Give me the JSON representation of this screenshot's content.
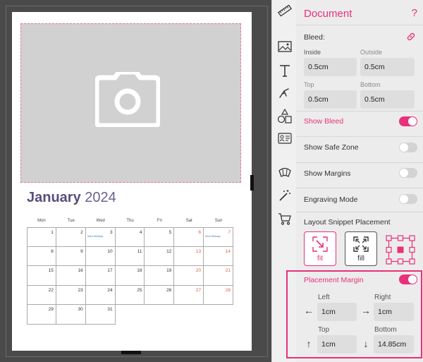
{
  "calendar": {
    "month": "January",
    "year": "2024",
    "weekdays": [
      "Mon",
      "Tue",
      "Wed",
      "Thu",
      "Fri",
      "Sat",
      "Sun"
    ],
    "leading_blanks": 0,
    "days": [
      {
        "d": "1"
      },
      {
        "d": "2"
      },
      {
        "d": "3",
        "event": "Sab's Birthday"
      },
      {
        "d": "4"
      },
      {
        "d": "5"
      },
      {
        "d": "6",
        "weekend": true
      },
      {
        "d": "7",
        "weekend": true,
        "event": "Mum Birthday"
      },
      {
        "d": "8"
      },
      {
        "d": "9"
      },
      {
        "d": "10"
      },
      {
        "d": "11"
      },
      {
        "d": "12"
      },
      {
        "d": "13",
        "weekend": true
      },
      {
        "d": "14",
        "weekend": true
      },
      {
        "d": "15"
      },
      {
        "d": "16"
      },
      {
        "d": "17"
      },
      {
        "d": "18"
      },
      {
        "d": "19"
      },
      {
        "d": "20",
        "weekend": true
      },
      {
        "d": "21",
        "weekend": true
      },
      {
        "d": "22"
      },
      {
        "d": "23"
      },
      {
        "d": "24"
      },
      {
        "d": "25"
      },
      {
        "d": "26"
      },
      {
        "d": "27",
        "weekend": true
      },
      {
        "d": "28",
        "weekend": true
      },
      {
        "d": "29"
      },
      {
        "d": "30"
      },
      {
        "d": "31"
      }
    ]
  },
  "rail": {
    "items": [
      "ruler-icon",
      "image-icon",
      "text-icon",
      "clipart-icon",
      "shapes-icon",
      "id-card-icon",
      "layout-icon",
      "magic-wand-icon",
      "cart-icon"
    ]
  },
  "panel": {
    "title": "Document",
    "help_glyph": "?",
    "bleed": {
      "label": "Bleed:",
      "inside_label": "Inside",
      "inside_value": "0.5cm",
      "outside_label": "Outside",
      "outside_value": "0.5cm",
      "top_label": "Top",
      "top_value": "0.5cm",
      "bottom_label": "Bottom",
      "bottom_value": "0.5cm"
    },
    "toggles": [
      {
        "label": "Show Bleed",
        "on": true
      },
      {
        "label": "Show Safe Zone",
        "on": false
      },
      {
        "label": "Show Margins",
        "on": false
      },
      {
        "label": "Engraving Mode",
        "on": false
      }
    ],
    "snippet": {
      "label": "Layout Snippet Placement",
      "fit_label": "fit",
      "fill_label": "fill"
    },
    "placement_margin": {
      "label": "Placement Margin",
      "on": true,
      "left_label": "Left",
      "left_value": "1cm",
      "right_label": "Right",
      "right_value": "1cm",
      "top_label": "Top",
      "top_value": "1cm",
      "bottom_label": "Bottom",
      "bottom_value": "14.85cm"
    }
  },
  "colors": {
    "accent": "#e8317a",
    "calendar_title": "#5a4e7c",
    "weekend_number": "#e05a4a"
  }
}
